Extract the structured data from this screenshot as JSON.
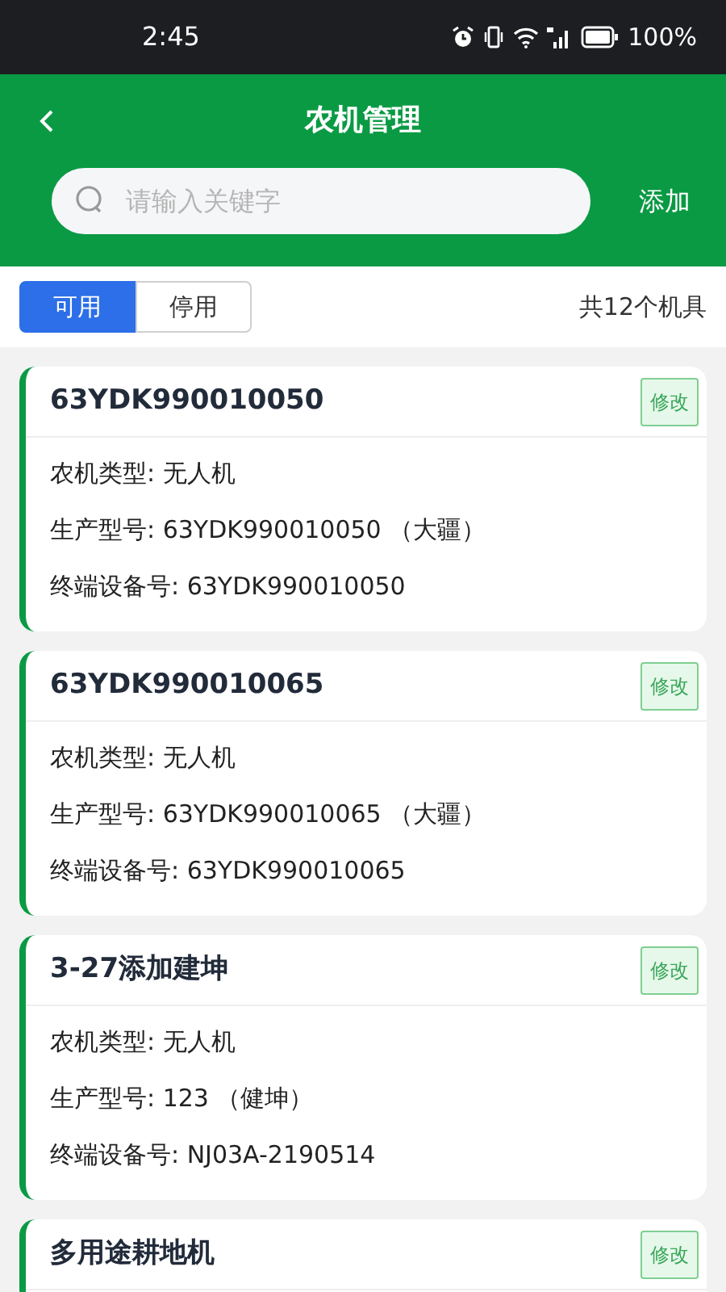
{
  "status_bar": {
    "time": "2:45",
    "battery": "100%"
  },
  "header": {
    "title": "农机管理"
  },
  "search": {
    "placeholder": "请输入关键字",
    "action": "添加"
  },
  "tabs": [
    {
      "label": "可用",
      "selected": true
    },
    {
      "label": "停用",
      "selected": false
    }
  ],
  "total": "共12个机具",
  "machines": [
    {
      "name": "63YDK990010050",
      "edit": "修改",
      "lines": [
        "农机类型: 无人机",
        "生产型号: 63YDK990010050 （大疆）",
        "终端设备号: 63YDK990010050"
      ]
    },
    {
      "name": "63YDK990010065",
      "edit": "修改",
      "lines": [
        "农机类型: 无人机",
        "生产型号: 63YDK990010065 （大疆）",
        "终端设备号: 63YDK990010065"
      ]
    },
    {
      "name": "3-27添加建坤",
      "edit": "修改",
      "lines": [
        "农机类型: 无人机",
        "生产型号: 123 （健坤）",
        "终端设备号: NJ03A-2190514"
      ]
    },
    {
      "name": "多用途耕地机",
      "edit": "修改"
    }
  ]
}
